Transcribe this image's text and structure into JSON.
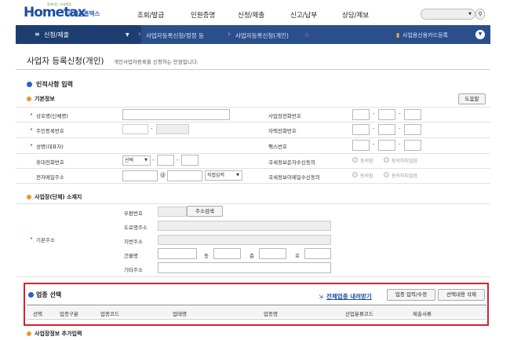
{
  "header": {
    "logo_main": "Hometax",
    "logo_sub": "국세청홈택스",
    "logo_tag": "함께하는 국세행정",
    "menu": [
      "조회/발급",
      "민원증명",
      "신청/제출",
      "신고/납부",
      "상담/제보"
    ]
  },
  "nav": {
    "section": "신청/제출",
    "crumb1": "사업자등록신청/정정 등",
    "crumb2": "사업자등록신청(개인)",
    "right": "사업용신용카드등록"
  },
  "page": {
    "title": "사업자 등록신청(개인)",
    "desc": "개인사업자등록을 신청하는 민원입니다."
  },
  "personal": {
    "title": "인적사항 입력",
    "basic": "기본정보",
    "help_button": "도움말",
    "labels": {
      "trade_name": "상호명(단체명)",
      "rrn": "주민등록번호",
      "name": "성명(대표자)",
      "mobile": "휴대전화번호",
      "email": "전자메일주소",
      "biz_phone": "사업장전화번호",
      "home_phone": "자택전화번호",
      "fax": "팩스번호",
      "sms_consent": "국세정보문자수신동의",
      "email_consent": "국세정보이메일수신동의"
    },
    "mobile_select": "선택",
    "email_at": "@",
    "email_domain_select": "직접입력",
    "agree": "동의함",
    "disagree": "동의하지않음"
  },
  "address": {
    "title": "사업장(단체) 소재지",
    "label": "기본주소",
    "postcode": "우편번호",
    "search_button": "주소검색",
    "road": "도로명주소",
    "lot": "지번주소",
    "building": "건물명",
    "dong": "동",
    "floor": "층",
    "ho": "호",
    "etc": "기타주소"
  },
  "industry": {
    "title": "업종 선택",
    "bulk_link": "전체업종 내려받기",
    "input_button": "업종 입력/수정",
    "delete_button": "선택내용 삭제",
    "columns": [
      "선택",
      "업종구분",
      "업종코드",
      "업태명",
      "업종명",
      "산업분류코드",
      "제출서류"
    ]
  },
  "extra": {
    "title": "사업장정보 추가입력"
  }
}
